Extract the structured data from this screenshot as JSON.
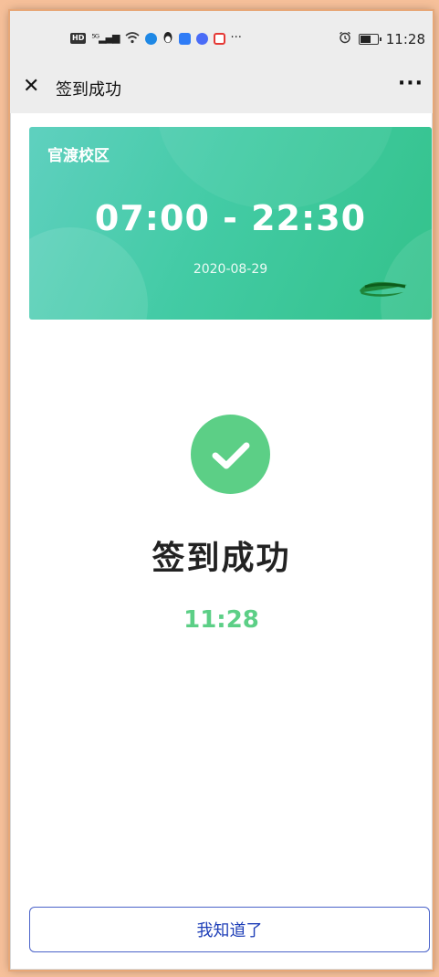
{
  "status_bar": {
    "indicators": [
      "HD",
      "5G",
      "wifi-icon",
      "qq-browser-icon",
      "qq-penguin-icon",
      "app-blue-icon",
      "music-icon",
      "app-red-icon",
      "..."
    ],
    "more_text": "···",
    "time": "11:28"
  },
  "navbar": {
    "close_icon": "close-icon",
    "close_glyph": "✕",
    "title": "签到成功",
    "more_glyph": "···"
  },
  "card": {
    "campus": "官渡校区",
    "hours": "07:00 - 22:30",
    "date": "2020-08-29",
    "colors": {
      "gradient_start": "#5fd0bf",
      "gradient_end": "#33c28a"
    }
  },
  "result": {
    "icon": "check-circle-icon",
    "title": "签到成功",
    "time": "11:28",
    "accent_color": "#5ccf86"
  },
  "footer": {
    "ok_label": "我知道了",
    "button_color": "#4b63c9"
  }
}
